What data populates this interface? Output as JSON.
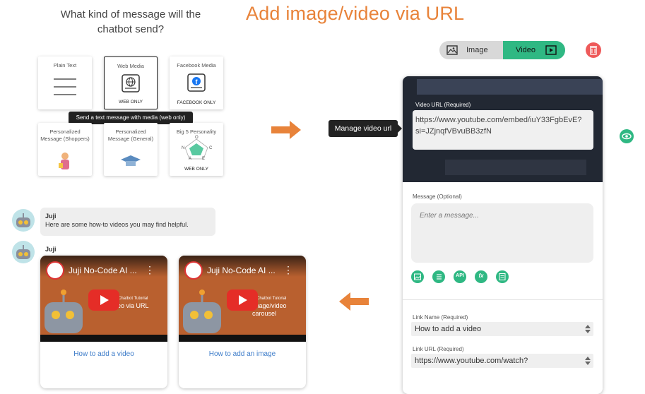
{
  "header": {
    "question": "What kind of message will the chatbot send?",
    "headline": "Add image/video via URL"
  },
  "types": [
    {
      "label": "Plain Text",
      "sub": ""
    },
    {
      "label": "Web Media",
      "sub": "WEB ONLY"
    },
    {
      "label": "Facebook Media",
      "sub": "FACEBOOK ONLY"
    },
    {
      "label": "Personalized Message (Shoppers)",
      "sub": ""
    },
    {
      "label": "Personalized Message (General)",
      "sub": ""
    },
    {
      "label": "Big 5 Personality",
      "sub": "WEB ONLY"
    }
  ],
  "tooltip": "Send a text message with media (web only)",
  "big5_letters": [
    "O",
    "N",
    "C",
    "A",
    "E"
  ],
  "chat": {
    "bot_name": "Juji",
    "message": "Here are some how-to videos you may find helpful.",
    "videos": [
      {
        "title": "Juji No-Code AI ...",
        "overlay_small": "Chatbot Tutorial",
        "overlay": "deo via URL",
        "link": "How to add a video"
      },
      {
        "title": "Juji No-Code AI ...",
        "overlay_small": "Chatbot Tutorial",
        "overlay": "image/video carousel",
        "link": "How to add an image"
      }
    ]
  },
  "editor": {
    "toggle": {
      "image": "Image",
      "video": "Video",
      "active": "video"
    },
    "manage_tag": "Manage video url",
    "video_url_label": "Video URL (Required)",
    "video_url_value": "https://www.youtube.com/embed/iuY33FgbEvE?si=JZjnqfVBvuBB3zfN",
    "message_label": "Message (Optional)",
    "message_placeholder": "Enter a message...",
    "tools": [
      "image-tool",
      "list-tool",
      "api-tool",
      "function-tool",
      "form-tool"
    ],
    "tool_api_text": "API",
    "tool_fx_text": "fx",
    "link_name_label": "Link Name (Required)",
    "link_name_value": "How to add a video",
    "link_url_label": "Link URL (Required)",
    "link_url_value": "https://www.youtube.com/watch?"
  },
  "colors": {
    "accent": "#e8833a",
    "green": "#2fb883",
    "trash": "#ee5a5a",
    "link": "#3d7cc9"
  }
}
